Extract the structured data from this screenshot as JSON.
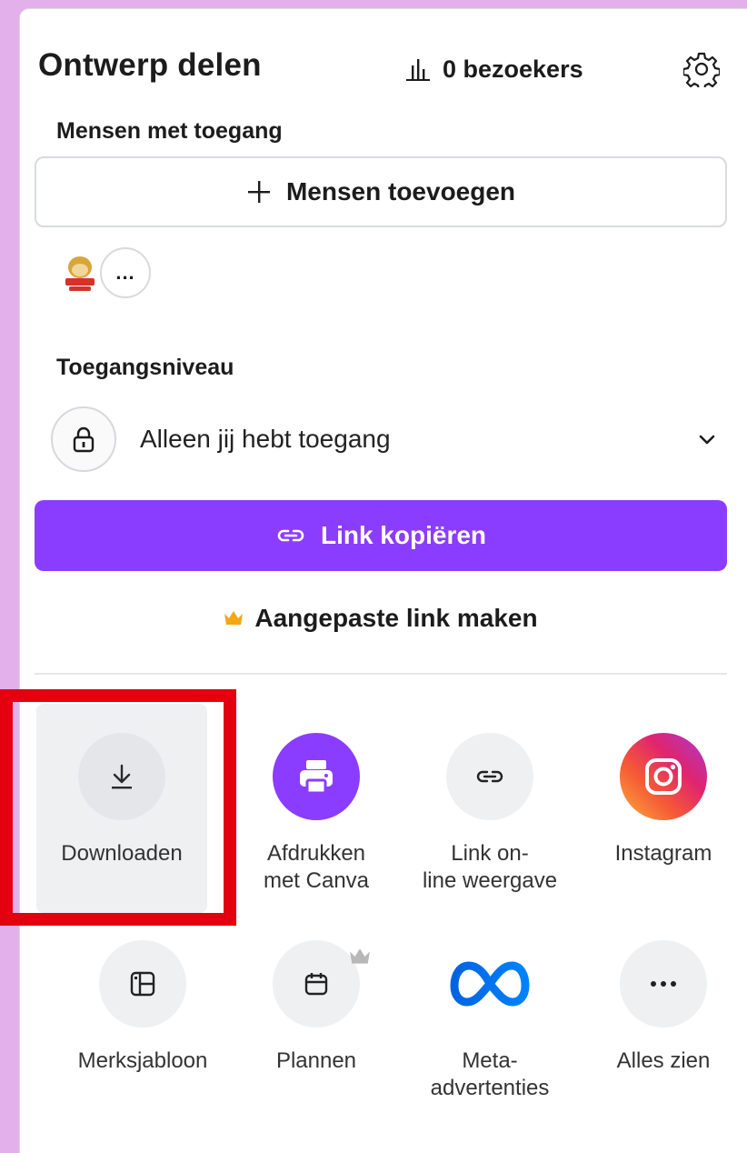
{
  "panel": {
    "title": "Ontwerp delen",
    "visitors": "0 bezoekers"
  },
  "people": {
    "label": "Mensen met toegang",
    "add_button": "Mensen toevoegen",
    "more": "..."
  },
  "access": {
    "label": "Toegangsniveau",
    "value": "Alleen jij hebt toegang"
  },
  "actions": {
    "copy_link": "Link kopiëren",
    "custom_link": "Aangepaste link maken"
  },
  "share_options": [
    {
      "label_line1": "Downloaden",
      "label_line2": ""
    },
    {
      "label_line1": "Afdrukken",
      "label_line2": "met Canva"
    },
    {
      "label_line1": "Link on-",
      "label_line2": "line weergave"
    },
    {
      "label_line1": "Instagram",
      "label_line2": ""
    },
    {
      "label_line1": "Merksjabloon",
      "label_line2": ""
    },
    {
      "label_line1": "Plannen",
      "label_line2": ""
    },
    {
      "label_line1": "Meta-",
      "label_line2": "advertenties"
    },
    {
      "label_line1": "Alles zien",
      "label_line2": ""
    }
  ],
  "colors": {
    "accent": "#8b3dff",
    "background": "#e3b0ec",
    "highlight": "#e3010f",
    "crown": "#f3a712"
  },
  "icons": [
    "bar-chart-icon",
    "gear-icon",
    "plus-icon",
    "lock-icon",
    "chevron-down-icon",
    "link-icon",
    "crown-icon",
    "download-icon",
    "printer-icon",
    "instagram-icon",
    "brand-template-icon",
    "calendar-icon",
    "meta-icon",
    "more-icon"
  ]
}
